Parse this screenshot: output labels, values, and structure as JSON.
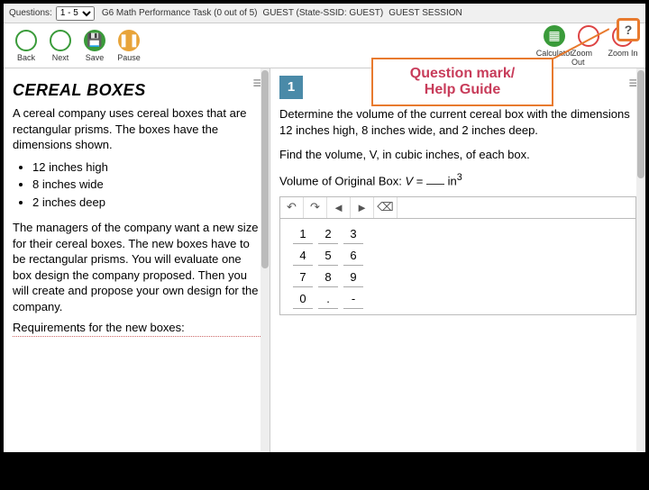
{
  "topbar": {
    "questions_label": "Questions:",
    "questions_value": "1 - 5",
    "task_info": "G6 Math Performance Task (0 out of 5)",
    "user_info": "GUEST (State-SSID: GUEST)",
    "session_info": "GUEST SESSION"
  },
  "toolbar": {
    "back": "Back",
    "next": "Next",
    "save": "Save",
    "pause": "Pause",
    "calculator": "Calculator",
    "zoom_out": "Zoom Out",
    "zoom_in": "Zoom In"
  },
  "help_icon": "?",
  "callout": {
    "line1": "Question mark/",
    "line2": "Help Guide"
  },
  "left": {
    "title": "CEREAL BOXES",
    "p1": "A cereal company uses cereal boxes that are rectangular prisms. The boxes have the dimensions shown.",
    "bullets": [
      "12 inches high",
      "8 inches wide",
      "2 inches deep"
    ],
    "p2": "The managers of the company want a new size for their cereal boxes. The new boxes have to be rectangular prisms. You will evaluate one box design the company proposed. Then you will create and propose your own design for the company.",
    "p3": "Requirements for the new boxes:"
  },
  "right": {
    "qnum": "1",
    "q1": "Determine the volume of the current cereal box with the dimensions 12 inches high, 8 inches wide, and 2 inches deep.",
    "q2": "Find the volume, V, in cubic inches, of each box.",
    "formula_label": "Volume of Original Box:",
    "formula_var": "V",
    "formula_eq": " = ",
    "formula_unit": " in",
    "formula_exp": "3",
    "keypad": {
      "r1": [
        "1",
        "2",
        "3"
      ],
      "r2": [
        "4",
        "5",
        "6"
      ],
      "r3": [
        "7",
        "8",
        "9"
      ],
      "r4": [
        "0",
        ".",
        "-"
      ]
    }
  }
}
